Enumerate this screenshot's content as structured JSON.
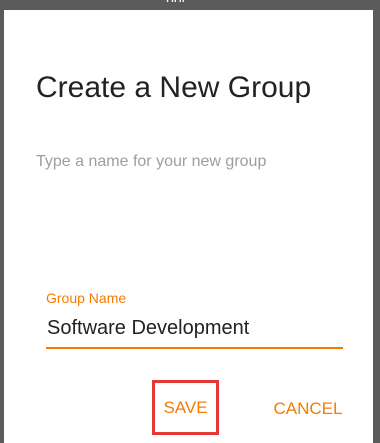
{
  "window": {
    "top_text": "ppr"
  },
  "dialog": {
    "title": "Create a New Group",
    "subtitle": "Type a name for your new group"
  },
  "form": {
    "group_name": {
      "label": "Group Name",
      "value": "Software Development"
    }
  },
  "actions": {
    "save_label": "SAVE",
    "cancel_label": "CANCEL"
  },
  "colors": {
    "accent": "#f57c00",
    "highlight_box": "#e53935",
    "window_frame": "#5b5b5b"
  }
}
